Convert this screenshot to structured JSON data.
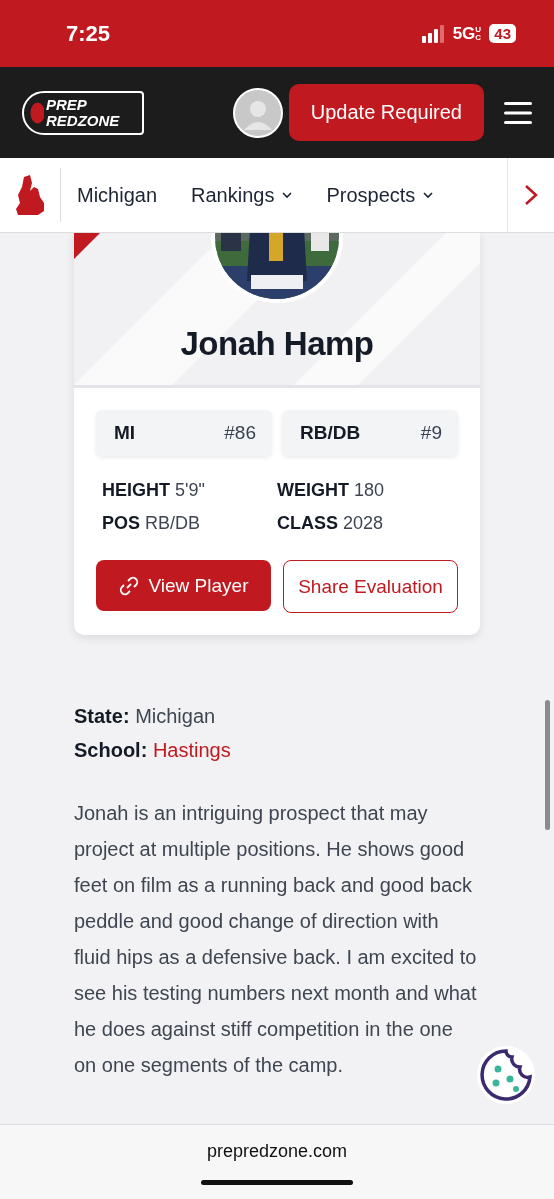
{
  "status_bar": {
    "time": "7:25",
    "network": "5G",
    "network_sub": "UC",
    "battery": "43"
  },
  "header": {
    "logo_lines": [
      "PREP",
      "REDZONE"
    ],
    "update_button": "Update Required"
  },
  "nav": {
    "items": [
      {
        "label": "Michigan",
        "dropdown": false
      },
      {
        "label": "Rankings",
        "dropdown": true
      },
      {
        "label": "Prospects",
        "dropdown": true
      }
    ]
  },
  "player_card": {
    "name": "Jonah Hamp",
    "ranks": [
      {
        "label": "MI",
        "rank": "#86"
      },
      {
        "label": "RB/DB",
        "rank": "#9"
      }
    ],
    "stats": [
      {
        "label": "HEIGHT",
        "value": "5'9\""
      },
      {
        "label": "WEIGHT",
        "value": "180"
      },
      {
        "label": "POS",
        "value": "RB/DB"
      },
      {
        "label": "CLASS",
        "value": "2028"
      }
    ],
    "view_button": "View Player",
    "share_button": "Share Evaluation"
  },
  "details": [
    {
      "label": "State:",
      "value": "Michigan",
      "link": false
    },
    {
      "label": "School:",
      "value": "Hastings",
      "link": true
    }
  ],
  "evaluation": "Jonah is an intriguing prospect that may project at multiple positions. He shows good feet on film as a running back and good back peddle and good change of direction with fluid hips as a defensive back. I am excited to see his testing numbers next month and what he does against stiff competition in the one on one segments of the camp.",
  "url_bar": {
    "domain": "prepredzone.com"
  }
}
